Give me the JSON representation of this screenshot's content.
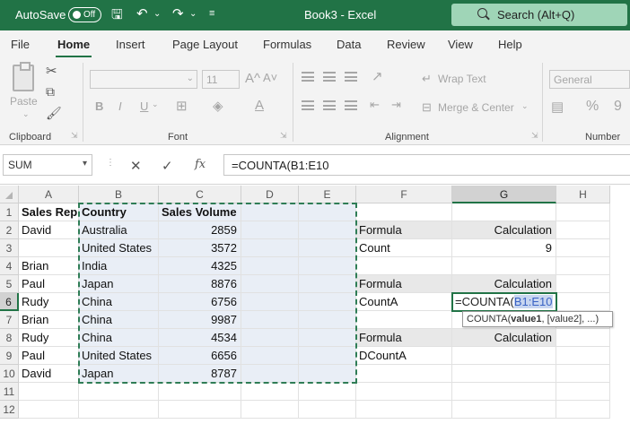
{
  "titlebar": {
    "autosave_label": "AutoSave",
    "autosave_state": "Off",
    "doc_title": "Book3 - Excel",
    "search_placeholder": "Search (Alt+Q)",
    "bg_color": "#217346"
  },
  "menu": {
    "tabs": [
      "File",
      "Home",
      "Insert",
      "Page Layout",
      "Formulas",
      "Data",
      "Review",
      "View",
      "Help"
    ],
    "active": "Home"
  },
  "ribbon": {
    "paste_label": "Paste",
    "groups": {
      "clipboard": "Clipboard",
      "font": "Font",
      "alignment": "Alignment",
      "number": "Number"
    },
    "font_size": "11",
    "wrap_text": "Wrap Text",
    "merge_center": "Merge & Center",
    "number_format": "General",
    "bold": "B",
    "italic": "I",
    "underline": "U",
    "grow_font": "A^",
    "shrink_font": "A˅",
    "percent": "%",
    "comma": "9"
  },
  "formula_bar": {
    "name_box": "SUM",
    "cancel": "✕",
    "enter": "✓",
    "fx": "fx",
    "formula": "=COUNTA(B1:E10"
  },
  "sheet": {
    "columns": [
      "A",
      "B",
      "C",
      "D",
      "E",
      "F",
      "G",
      "H"
    ],
    "rows": [
      "1",
      "2",
      "3",
      "4",
      "5",
      "6",
      "7",
      "8",
      "9",
      "10",
      "11",
      "12"
    ],
    "cells": {
      "A1": "Sales Rep",
      "B1": "Country",
      "C1": "Sales Volume",
      "A2": "David",
      "B2": "Australia",
      "C2": "2859",
      "A3": "",
      "B3": "United States",
      "C3": "3572",
      "A4": "Brian",
      "B4": "India",
      "C4": "4325",
      "A5": "Paul",
      "B5": "Japan",
      "C5": "8876",
      "A6": "Rudy",
      "B6": "China",
      "C6": "6756",
      "A7": "Brian",
      "B7": "China",
      "C7": "9987",
      "A8": "Rudy",
      "B8": "China",
      "C8": "4534",
      "A9": "Paul",
      "B9": "United States",
      "C9": "6656",
      "A10": "David",
      "B10": "Japan",
      "C10": "8787",
      "F2": "Formula",
      "G2": "Calculation",
      "F3": "Count",
      "G3": "9",
      "F5": "Formula",
      "G5": "Calculation",
      "F6": "CountA",
      "F8": "Formula",
      "G8": "Calculation",
      "F9": "DCountA"
    },
    "active_cell_prefix": "=COUNTA(",
    "active_cell_ref": "B1:E10",
    "tooltip_fn": "COUNTA(",
    "tooltip_arg1": "value1",
    "tooltip_rest": ", [value2], ...)"
  }
}
